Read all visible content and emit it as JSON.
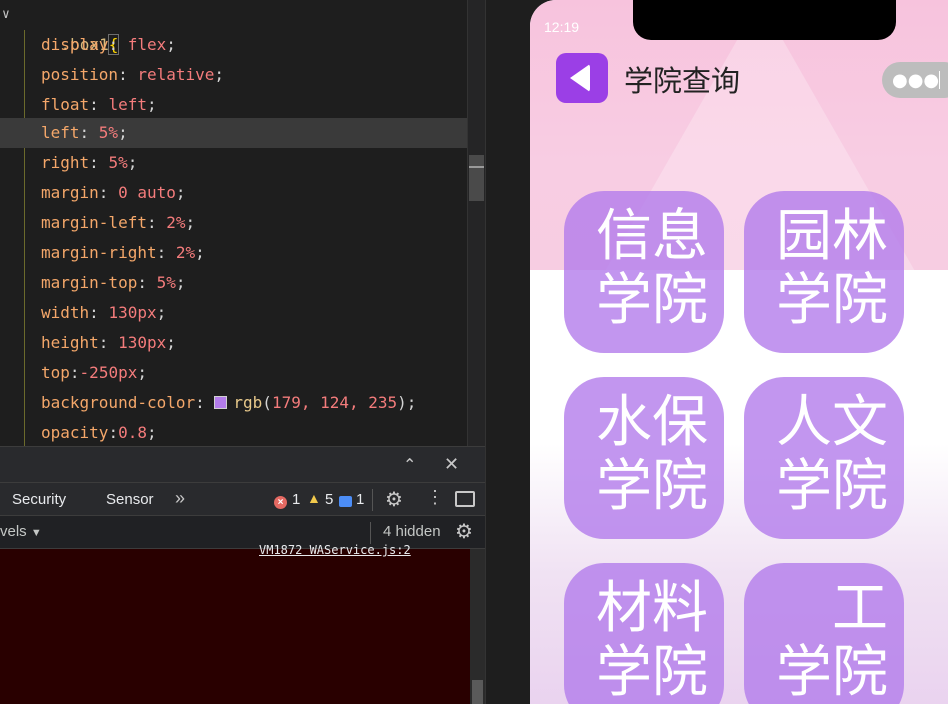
{
  "editor": {
    "selector": ".box1",
    "brace": "{",
    "lines": [
      {
        "prop": "display",
        "value": "flex"
      },
      {
        "prop": "position",
        "value": "relative"
      },
      {
        "prop": "float",
        "value": "left"
      },
      {
        "prop": "left",
        "value": "5%"
      },
      {
        "prop": "right",
        "value": "5%"
      },
      {
        "prop": "margin",
        "value": "0 auto"
      },
      {
        "prop": "margin-left",
        "value": "2%"
      },
      {
        "prop": "margin-right",
        "value": "2%"
      },
      {
        "prop": "margin-top",
        "value": "5%"
      },
      {
        "prop": "width",
        "value": "130px"
      },
      {
        "prop": "height",
        "value": "130px"
      },
      {
        "prop": "top",
        "value": "-250px"
      },
      {
        "prop": "background-color",
        "value_fn": "rgb",
        "value_args": "179, 124, 235",
        "swatch": "#b37ceb"
      },
      {
        "prop": "opacity",
        "value": "0.8"
      }
    ],
    "highlighted_line": "left: 5%"
  },
  "devtools": {
    "tabs": [
      "Security",
      "Sensor"
    ],
    "more_tabs": "»",
    "error_count": "1",
    "warning_count": "5",
    "message_count": "1",
    "levels_label": "vels",
    "hidden_label": "4 hidden",
    "source_link": "VM1872 WAService.js:2"
  },
  "phone": {
    "time": "12:19",
    "title": "学院查询",
    "accent": "#9b3fe6",
    "tile_color": "rgb(179, 124, 235)",
    "tiles": [
      {
        "line1": "信息",
        "line2": "学院"
      },
      {
        "line1": "园林",
        "line2": "学院"
      },
      {
        "line1": "水保",
        "line2": "学院"
      },
      {
        "line1": "人文",
        "line2": "学院"
      },
      {
        "line1": "材料",
        "line2": "学院"
      },
      {
        "line1": "工",
        "line2": "学院"
      }
    ]
  }
}
